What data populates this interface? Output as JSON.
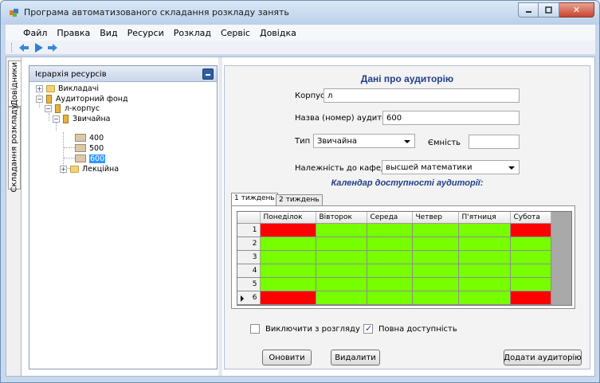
{
  "window": {
    "title": "Програма автоматизованого складання розкладу занять",
    "colors": {
      "titlebar": "#c9daef",
      "close": "#c7452e"
    }
  },
  "menu": {
    "items": [
      "Файл",
      "Правка",
      "Вид",
      "Ресурси",
      "Розклад",
      "Сервіс",
      "Довідка"
    ]
  },
  "toolbar": {
    "buttons": [
      "arrow-left-icon",
      "play-icon",
      "arrow-right-icon"
    ]
  },
  "side_tabs": {
    "items": [
      {
        "label": "Довідники",
        "active": true
      },
      {
        "label": "Складання розкладу",
        "active": false
      }
    ]
  },
  "resource_panel": {
    "title": "Ієрархія ресурсів",
    "tree": [
      {
        "label": "Викладачі",
        "expander": "+"
      },
      {
        "label": "Аудиторний фонд",
        "expander": "−"
      },
      {
        "label": "л-корпус",
        "expander": "−"
      },
      {
        "label": "Звичайна",
        "expander": "−"
      },
      {
        "label": "400"
      },
      {
        "label": "500"
      },
      {
        "label": "600",
        "selected": true
      },
      {
        "label": "Лекційна",
        "expander": "+"
      }
    ]
  },
  "details": {
    "heading": "Дані про аудиторію",
    "building_label": "Корпус",
    "building_value": "л",
    "room_label": "Назва (номер) аудиторії",
    "room_value": "600",
    "type_label": "Тип",
    "type_value": "Звичайна",
    "capacity_label": "Ємність",
    "capacity_value": "",
    "department_label": "Належність до кафедри",
    "department_value": "высшей математики"
  },
  "calendar": {
    "heading": "Календар доступності аудиторії:",
    "tabs": [
      "1 тиждень",
      "2 тиждень"
    ],
    "active_tab": 0,
    "columns": [
      "Понеділок",
      "Вівторок",
      "Середа",
      "Четвер",
      "П'ятниця",
      "Субота"
    ],
    "rows": [
      {
        "num": "1",
        "cells": [
          "red",
          "green",
          "green",
          "green",
          "green",
          "red"
        ]
      },
      {
        "num": "2",
        "cells": [
          "green",
          "green",
          "green",
          "green",
          "green",
          "green"
        ]
      },
      {
        "num": "3",
        "cells": [
          "green",
          "green",
          "green",
          "green",
          "green",
          "green"
        ]
      },
      {
        "num": "4",
        "cells": [
          "green",
          "green",
          "green",
          "green",
          "green",
          "green"
        ]
      },
      {
        "num": "5",
        "cells": [
          "green",
          "green",
          "green",
          "green",
          "green",
          "green"
        ]
      },
      {
        "num": "6",
        "cells": [
          "red",
          "green",
          "green",
          "green",
          "green",
          "red"
        ]
      }
    ],
    "colors": {
      "available": "#77ff00",
      "unavailable": "#ff0000"
    }
  },
  "options": {
    "exclude_label": "Виключити з розгляду",
    "exclude_checked": false,
    "full_label": "Повна доступність",
    "full_checked": true
  },
  "buttons": {
    "refresh": "Оновити",
    "delete": "Видалити",
    "add": "Додати аудиторію"
  }
}
